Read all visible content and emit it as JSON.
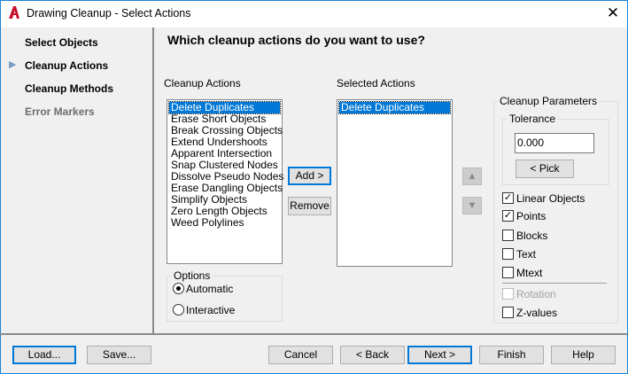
{
  "window": {
    "title": "Drawing Cleanup - Select Actions",
    "close": "✕"
  },
  "nav": {
    "items": [
      {
        "label": "Select Objects"
      },
      {
        "label": "Cleanup Actions"
      },
      {
        "label": "Cleanup Methods"
      },
      {
        "label": "Error Markers"
      }
    ],
    "current_marker": "▶"
  },
  "heading": "Which cleanup actions do you want to use?",
  "cleanup_actions": {
    "label": "Cleanup Actions",
    "items": [
      "Delete Duplicates",
      "Erase Short Objects",
      "Break Crossing Objects",
      "Extend Undershoots",
      "Apparent Intersection",
      "Snap Clustered Nodes",
      "Dissolve Pseudo Nodes",
      "Erase Dangling Objects",
      "Simplify Objects",
      "Zero Length Objects",
      "Weed Polylines"
    ]
  },
  "selected_actions": {
    "label": "Selected Actions",
    "items": [
      "Delete Duplicates"
    ]
  },
  "buttons": {
    "add": "Add >",
    "remove": "Remove",
    "up": "▲",
    "down": "▼"
  },
  "options": {
    "label": "Options",
    "automatic": "Automatic",
    "interactive": "Interactive",
    "selected": "automatic"
  },
  "params": {
    "label": "Cleanup Parameters",
    "tolerance_label": "Tolerance",
    "tolerance_value": "0.000",
    "pick": "< Pick",
    "checks": [
      {
        "label": "Linear Objects",
        "checked": true
      },
      {
        "label": "Points",
        "checked": true
      },
      {
        "label": "Blocks",
        "checked": false
      },
      {
        "label": "Text",
        "checked": false
      },
      {
        "label": "Mtext",
        "checked": false
      }
    ],
    "rotation": "Rotation",
    "zvalues": "Z-values"
  },
  "footer": {
    "load": "Load...",
    "save": "Save...",
    "cancel": "Cancel",
    "back": "< Back",
    "next": "Next >",
    "finish": "Finish",
    "help": "Help"
  }
}
